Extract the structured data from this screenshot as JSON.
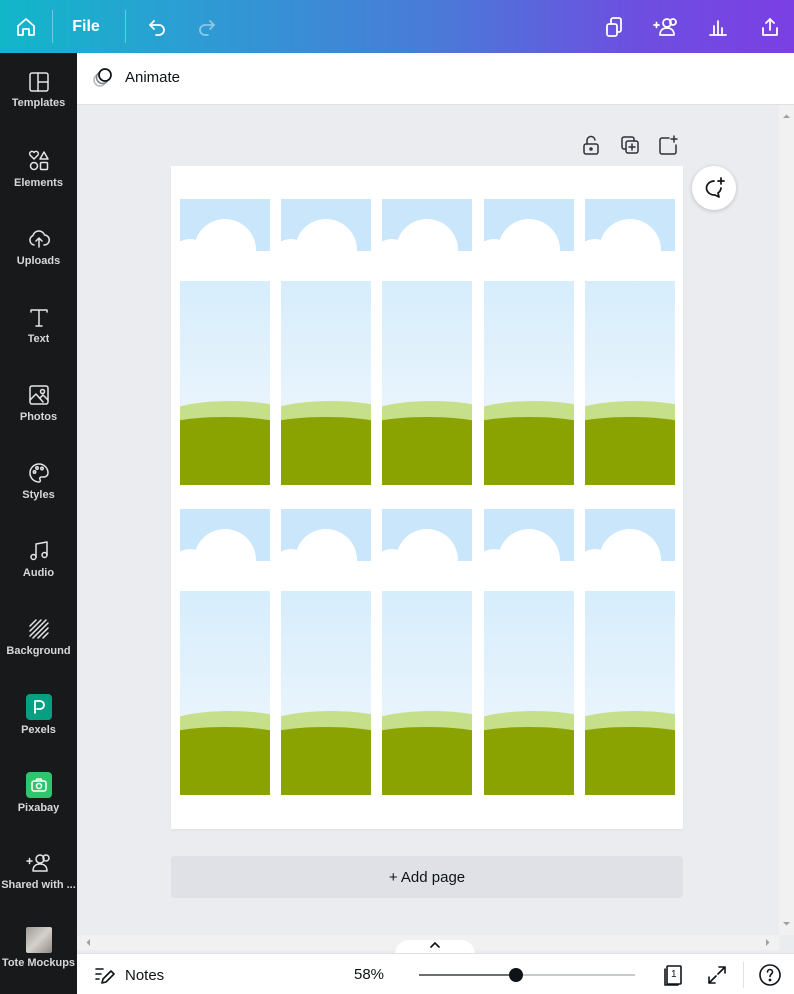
{
  "topbar": {
    "home_icon": "home-icon",
    "file_label": "File",
    "undo_icon": "undo-icon",
    "redo_icon": "redo-icon",
    "right_icons": [
      "resize-icon",
      "share-people-icon",
      "insights-icon",
      "upload-share-icon"
    ]
  },
  "sidebar": {
    "items": [
      {
        "label": "Templates",
        "icon": "templates-icon"
      },
      {
        "label": "Elements",
        "icon": "elements-icon"
      },
      {
        "label": "Uploads",
        "icon": "cloud-upload-icon"
      },
      {
        "label": "Text",
        "icon": "text-icon"
      },
      {
        "label": "Photos",
        "icon": "photos-icon"
      },
      {
        "label": "Styles",
        "icon": "palette-icon"
      },
      {
        "label": "Audio",
        "icon": "music-note-icon"
      },
      {
        "label": "Background",
        "icon": "background-icon"
      },
      {
        "label": "Pexels",
        "icon": "pexels-icon"
      },
      {
        "label": "Pixabay",
        "icon": "pixabay-icon"
      },
      {
        "label": "Shared with ...",
        "icon": "shared-people-icon"
      },
      {
        "label": "Tote Mockups",
        "icon": "folder-thumbnail"
      }
    ],
    "colors": {
      "pexels": "#05a081",
      "pixabay": "#2ec66d"
    }
  },
  "animbar": {
    "animate_label": "Animate"
  },
  "page": {
    "tools": [
      "lock-icon",
      "duplicate-page-icon",
      "add-page-icon"
    ],
    "comment_icon": "add-comment-icon",
    "grid_rows": 2,
    "grid_cols": 5
  },
  "add_page_label": "+ Add page",
  "bottombar": {
    "notes_label": "Notes",
    "zoom_label": "58%",
    "zoom_fraction": 0.45,
    "page_count": "1",
    "icons": [
      "page-count-icon",
      "fullscreen-icon",
      "help-icon"
    ]
  }
}
